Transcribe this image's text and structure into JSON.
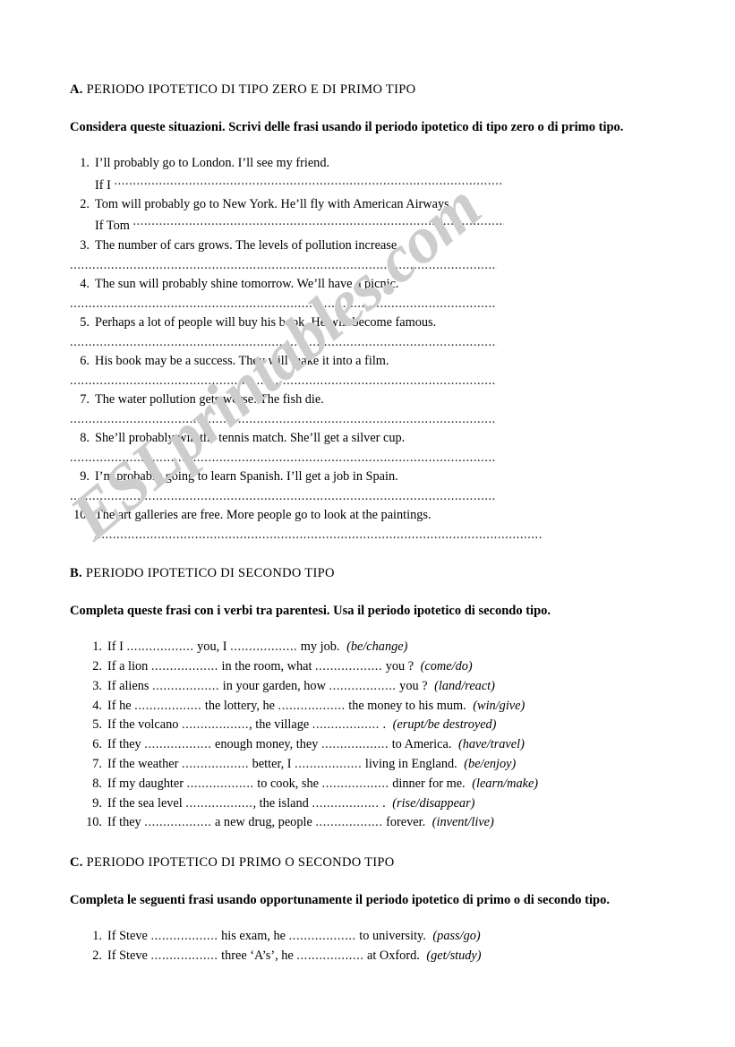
{
  "watermark": {
    "text": "ESLprintables.com",
    "color": "#cdcdcd"
  },
  "sections": {
    "a": {
      "letter": "A.",
      "title": "PERIODO IPOTETICO DI TIPO ZERO E DI PRIMO TIPO",
      "instruction": "Considera queste situazioni. Scrivi delle frasi usando il periodo ipotetico di tipo zero o di primo tipo.",
      "items": [
        {
          "n": "1.",
          "text": "I’ll probably go to London. I’ll see my friend.",
          "lead_prefix": "If I",
          "dots": 0
        },
        {
          "n": "2.",
          "text": "Tom will probably go to New York. He’ll fly with American Airways.",
          "lead_prefix": "If Tom",
          "dots": 0
        },
        {
          "n": "3.",
          "text": "The number of cars grows. The levels of pollution increase.",
          "lead_prefix": "",
          "dots": 0
        },
        {
          "n": "4.",
          "text": "The sun will probably shine tomorrow. We’ll have a picnic.",
          "lead_prefix": "",
          "dots": 0
        },
        {
          "n": "5.",
          "text": "Perhaps a lot of people will buy his book. He will become famous.",
          "lead_prefix": "",
          "dots": 0
        },
        {
          "n": "6.",
          "text": "His book may be a success. They will make it into a film.",
          "lead_prefix": "",
          "dots": 0
        },
        {
          "n": "7.",
          "text": "The water pollution gets worse. The fish die.",
          "lead_prefix": "",
          "dots": 0
        },
        {
          "n": "8.",
          "text": "She’ll probably win the tennis match. She’ll get a silver cup.",
          "lead_prefix": "",
          "dots": 0
        },
        {
          "n": "9.",
          "text": "I’m probably going to learn Spanish. I’ll get a job in Spain.",
          "lead_prefix": "",
          "dots": 0
        },
        {
          "n": "10.",
          "text": "The art galleries are free. More people go to look at the paintings.",
          "lead_prefix": "",
          "dots": 0
        }
      ]
    },
    "b": {
      "letter": "B.",
      "title": "PERIODO IPOTETICO DI SECONDO TIPO",
      "instruction": "Completa queste frasi  con i verbi tra parentesi. Usa il periodo ipotetico di secondo tipo.",
      "items": [
        {
          "n": "1.",
          "p1": "If I ",
          "p2": " you, I ",
          "p3": " my job.",
          "verbs": "(be/change)"
        },
        {
          "n": "2.",
          "p1": "If a lion ",
          "p2": " in the room, what ",
          "p3": " you ",
          "p4": "?",
          "verbs": "(come/do)"
        },
        {
          "n": "3.",
          "p1": "If aliens ",
          "p2": " in your garden, how ",
          "p3": " you ",
          "p4": "?",
          "verbs": "(land/react)"
        },
        {
          "n": "4.",
          "p1": "If he ",
          "p2": " the lottery, he ",
          "p3": " the money to his mum.",
          "verbs": "(win/give)"
        },
        {
          "n": "5.",
          "p1": "If the volcano ",
          "p2": ", the village ",
          "p3": " .",
          "verbs": "(erupt/be destroyed)"
        },
        {
          "n": "6.",
          "p1": "If they ",
          "p2": " enough money, they ",
          "p3": " to America.",
          "verbs": "(have/travel)"
        },
        {
          "n": "7.",
          "p1": "If the weather ",
          "p2": " better, I ",
          "p3": " living in England.",
          "verbs": "(be/enjoy)"
        },
        {
          "n": "8.",
          "p1": "If my daughter ",
          "p2": " to cook, she ",
          "p3": " dinner for me.",
          "verbs": "(learn/make)"
        },
        {
          "n": "9.",
          "p1": "If the sea level ",
          "p2": ", the island ",
          "p3": " .",
          "verbs": "(rise/disappear)"
        },
        {
          "n": "10.",
          "p1": "If they ",
          "p2": " a new drug, people ",
          "p3": " forever.",
          "verbs": "(invent/live)"
        }
      ]
    },
    "c": {
      "letter": "C.",
      "title": "PERIODO IPOTETICO DI PRIMO O SECONDO TIPO",
      "instruction": "Completa le seguenti frasi usando opportunamente il periodo ipotetico di primo o di secondo tipo.",
      "items": [
        {
          "n": "1.",
          "p1": "If Steve ",
          "p2": " his exam, he ",
          "p3": " to university.",
          "verbs": "(pass/go)"
        },
        {
          "n": "2.",
          "p1": "If Steve ",
          "p2": " three ‘A’s’, he ",
          "p3": " at Oxford.",
          "verbs": "(get/study)"
        }
      ]
    }
  }
}
